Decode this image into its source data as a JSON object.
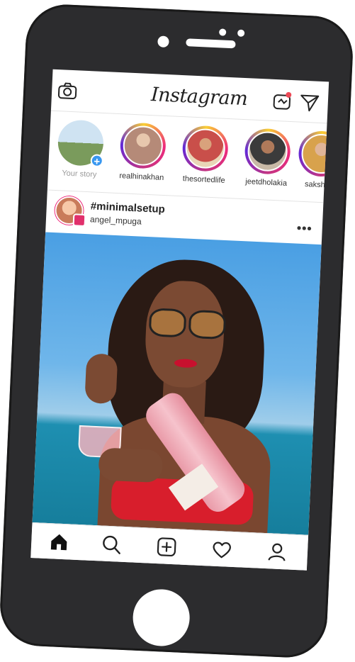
{
  "header": {
    "title": "Instagram",
    "camera_icon": "camera-icon",
    "igtv_icon": "igtv-icon",
    "direct_icon": "paper-plane-icon"
  },
  "stories": [
    {
      "label": "Your story",
      "own": true
    },
    {
      "label": "realhinakhan"
    },
    {
      "label": "thesortedlife"
    },
    {
      "label": "jeetdholakia"
    },
    {
      "label": "sakshisi"
    }
  ],
  "post": {
    "title": "#minimalsetup",
    "username": "angel_mpuga",
    "more": "•••"
  },
  "tabbar": {
    "items": [
      "home-icon",
      "search-icon",
      "add-post-icon",
      "heart-icon",
      "profile-icon"
    ]
  },
  "colors": {
    "story_ring": "#ee2a7b",
    "add_story": "#3897f0",
    "phone_body": "#2c2c2e"
  }
}
